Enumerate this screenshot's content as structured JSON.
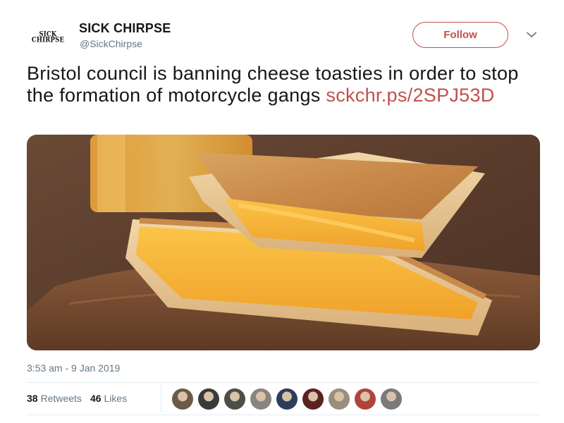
{
  "account": {
    "avatar_text_top": "SICK",
    "avatar_text_bottom": "CHIRPSE",
    "display_name": "SICK CHIRPSE",
    "handle": "@SickChirpse"
  },
  "follow_button": {
    "label": "Follow",
    "color": "#c0504d"
  },
  "menu": {
    "icon": "chevron-down-icon"
  },
  "tweet": {
    "text": "Bristol council is banning cheese toasties in order to stop the formation of motorcycle gangs ",
    "link": "sckchr.ps/2SPJ53D",
    "link_color": "#c0504d"
  },
  "media": {
    "description_icon": "grilled-cheese-photo"
  },
  "timestamp": "3:53 am - 9 Jan 2019",
  "stats": {
    "retweets_count": "38",
    "retweets_label": "Retweets",
    "likes_count": "46",
    "likes_label": "Likes"
  },
  "likers": [
    {
      "color": "#6b5a4a"
    },
    {
      "color": "#3a3a3a"
    },
    {
      "color": "#4b4f45"
    },
    {
      "color": "#8a8480"
    },
    {
      "color": "#2d3e5c"
    },
    {
      "color": "#5a2222"
    },
    {
      "color": "#9a8e7e"
    },
    {
      "color": "#b0443a"
    },
    {
      "color": "#7a7a7a"
    }
  ]
}
